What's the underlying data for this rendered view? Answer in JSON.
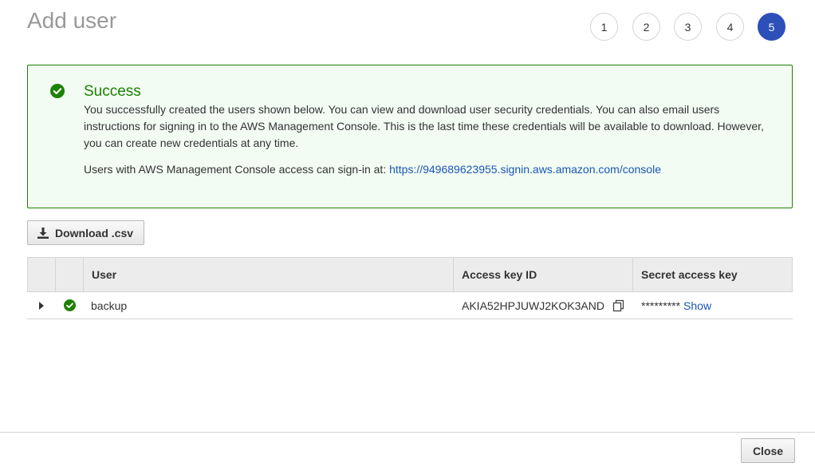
{
  "page": {
    "title": "Add user"
  },
  "steps": [
    "1",
    "2",
    "3",
    "4",
    "5"
  ],
  "current_step": "5",
  "alert": {
    "title": "Success",
    "body": "You successfully created the users shown below. You can view and download user security credentials. You can also email users instructions for signing in to the AWS Management Console. This is the last time these credentials will be available to download. However, you can create new credentials at any time.",
    "signin_prefix": "Users with AWS Management Console access can sign-in at: ",
    "signin_url": "https://949689623955.signin.aws.amazon.com/console"
  },
  "toolbar": {
    "download_label": "Download .csv"
  },
  "table": {
    "headers": {
      "user": "User",
      "access_key_id": "Access key ID",
      "secret_access_key": "Secret access key"
    },
    "rows": [
      {
        "user": "backup",
        "access_key_id": "AKIA52HPJUWJ2KOK3AND",
        "secret_masked": "*********",
        "show_label": "Show"
      }
    ]
  },
  "footer": {
    "close_label": "Close"
  },
  "colors": {
    "accent": "#2d4fb9",
    "success": "#1d8102",
    "link": "#1a56b5"
  }
}
